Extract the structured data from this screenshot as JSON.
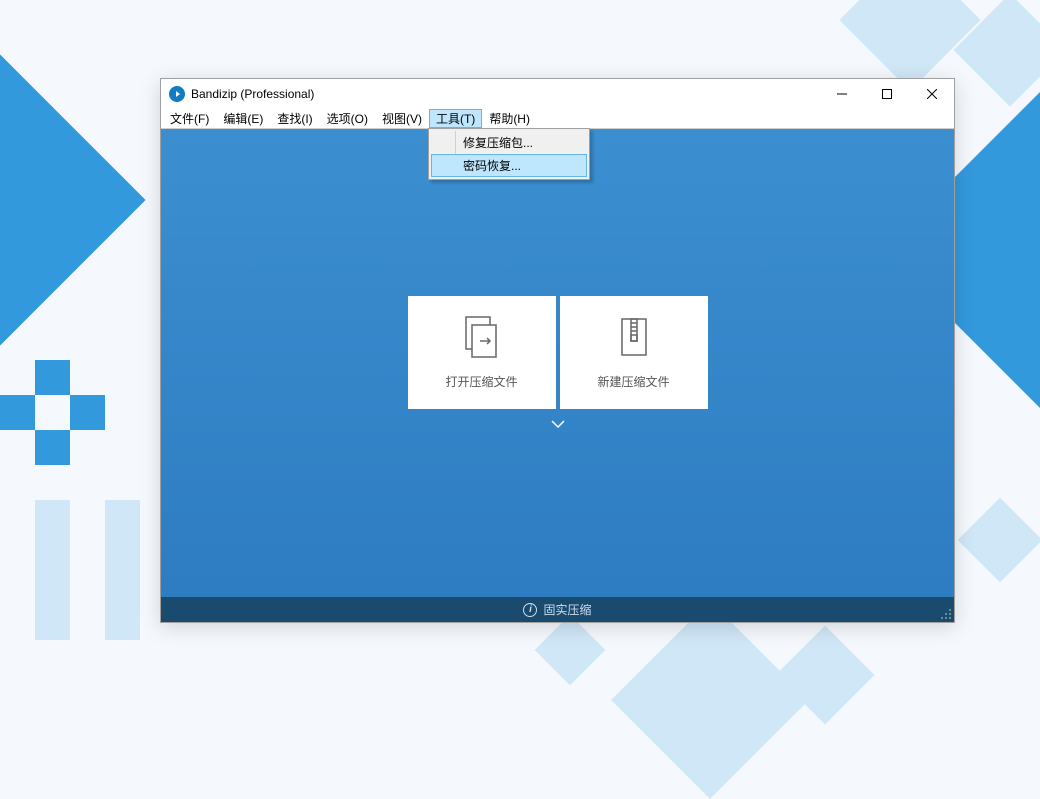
{
  "title": "Bandizip (Professional)",
  "menu": {
    "file": "文件(F)",
    "edit": "编辑(E)",
    "find": "查找(I)",
    "options": "选项(O)",
    "view": "视图(V)",
    "tools": "工具(T)",
    "help": "帮助(H)"
  },
  "dropdown": {
    "repair": "修复压缩包...",
    "recover": "密码恢复..."
  },
  "cards": {
    "open": "打开压缩文件",
    "new": "新建压缩文件"
  },
  "status": {
    "text": "固实压缩"
  }
}
